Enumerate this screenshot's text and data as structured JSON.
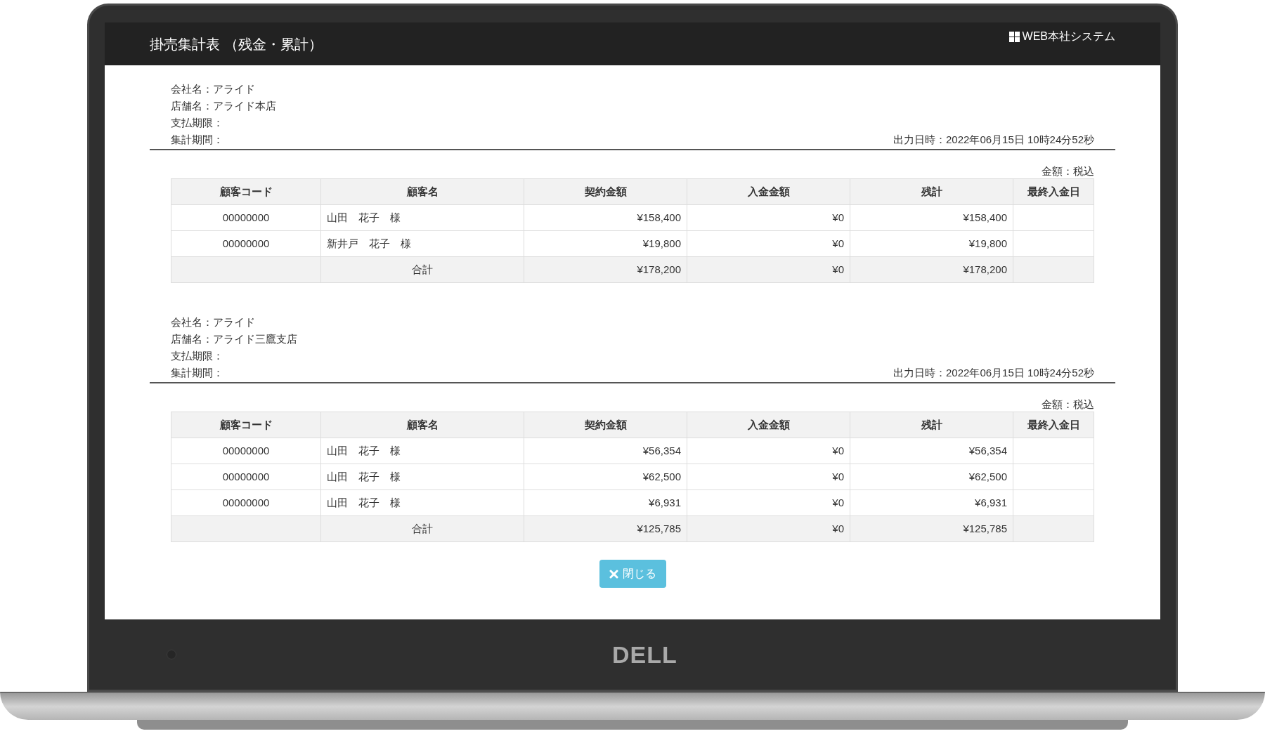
{
  "window": {
    "title": "掛売集計表 （残金・累計）",
    "system_name": "WEB本社システム"
  },
  "reports": [
    {
      "info": [
        "会社名：アライド",
        "店舗名：アライド本店",
        "支払期限：",
        "集計期間："
      ],
      "output_time": "出力日時：2022年06月15日 10時24分52秒",
      "tax_note": "金額：税込",
      "columns": [
        "顧客コード",
        "顧客名",
        "契約金額",
        "入金金額",
        "残計",
        "最終入金日"
      ],
      "rows": [
        {
          "code": "00000000",
          "name": "山田　花子　様",
          "contract": "¥158,400",
          "paid": "¥0",
          "balance": "¥158,400"
        },
        {
          "code": "00000000",
          "name": "新井戸　花子　様",
          "contract": "¥19,800",
          "paid": "¥0",
          "balance": "¥19,800"
        }
      ],
      "total": {
        "label": "合計",
        "contract": "¥178,200",
        "paid": "¥0",
        "balance": "¥178,200"
      }
    },
    {
      "info": [
        "会社名：アライド",
        "店舗名：アライド三鷹支店",
        "支払期限：",
        "集計期間："
      ],
      "output_time": "出力日時：2022年06月15日 10時24分52秒",
      "tax_note": "金額：税込",
      "columns": [
        "顧客コード",
        "顧客名",
        "契約金額",
        "入金金額",
        "残計",
        "最終入金日"
      ],
      "rows": [
        {
          "code": "00000000",
          "name": "山田　花子　様",
          "contract": "¥56,354",
          "paid": "¥0",
          "balance": "¥56,354"
        },
        {
          "code": "00000000",
          "name": "山田　花子　様",
          "contract": "¥62,500",
          "paid": "¥0",
          "balance": "¥62,500"
        },
        {
          "code": "00000000",
          "name": "山田　花子　様",
          "contract": "¥6,931",
          "paid": "¥0",
          "balance": "¥6,931"
        }
      ],
      "total": {
        "label": "合計",
        "contract": "¥125,785",
        "paid": "¥0",
        "balance": "¥125,785"
      }
    }
  ],
  "close_button": "閉じる",
  "device": {
    "logo": "DELL"
  }
}
